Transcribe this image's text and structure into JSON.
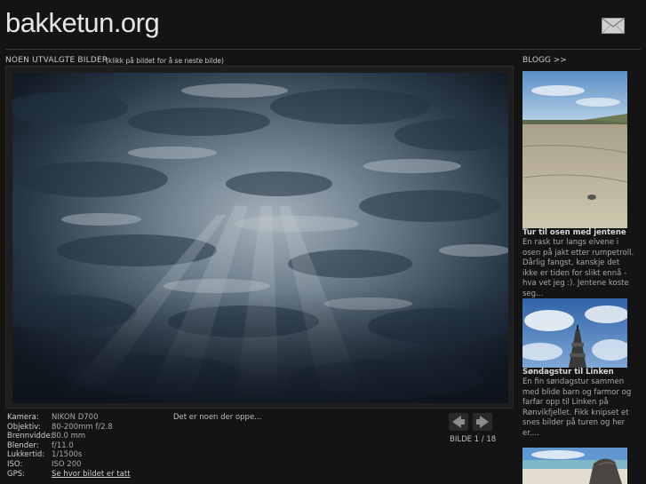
{
  "header": {
    "site_title": "bakketun.org",
    "mail_icon": "mail-icon"
  },
  "gallery": {
    "title": "NOEN UTVALGTE BILDER",
    "hint": "(klikk på bildet for å se neste bilde)",
    "caption": "Det er noen der oppe...",
    "counter": "BILDE 1 / 18",
    "prev_icon": "arrow-left-icon",
    "next_icon": "arrow-right-icon"
  },
  "exif": [
    {
      "label": "Kamera:",
      "value": "NIKON D700"
    },
    {
      "label": "Objektiv:",
      "value": "80-200mm f/2.8"
    },
    {
      "label": "Brennvidde:",
      "value": "80.0 mm"
    },
    {
      "label": "Blender:",
      "value": "f/11.0"
    },
    {
      "label": "Lukkertid:",
      "value": "1/1500s"
    },
    {
      "label": "ISO:",
      "value": "ISO 200"
    },
    {
      "label": "GPS:",
      "value": "Se hvor bildet er tatt"
    }
  ],
  "blog": {
    "heading": "BLOGG >>",
    "posts": [
      {
        "title": "Tur til osen med jentene",
        "excerpt": "En rask tur langs elvene i osen på jakt etter rumpetroll. Dårlig fangst, kanskje det ikke er tiden for slikt ennå - hva vet jeg :). Jentene koste seg..."
      },
      {
        "title": "Søndagstur til Linken",
        "excerpt": "En fin søndagstur sammen med blide barn og farmor og farfar opp til Linken på Rønvikfjellet. Fikk knipset et snes bilder på turen og her er...."
      }
    ]
  }
}
